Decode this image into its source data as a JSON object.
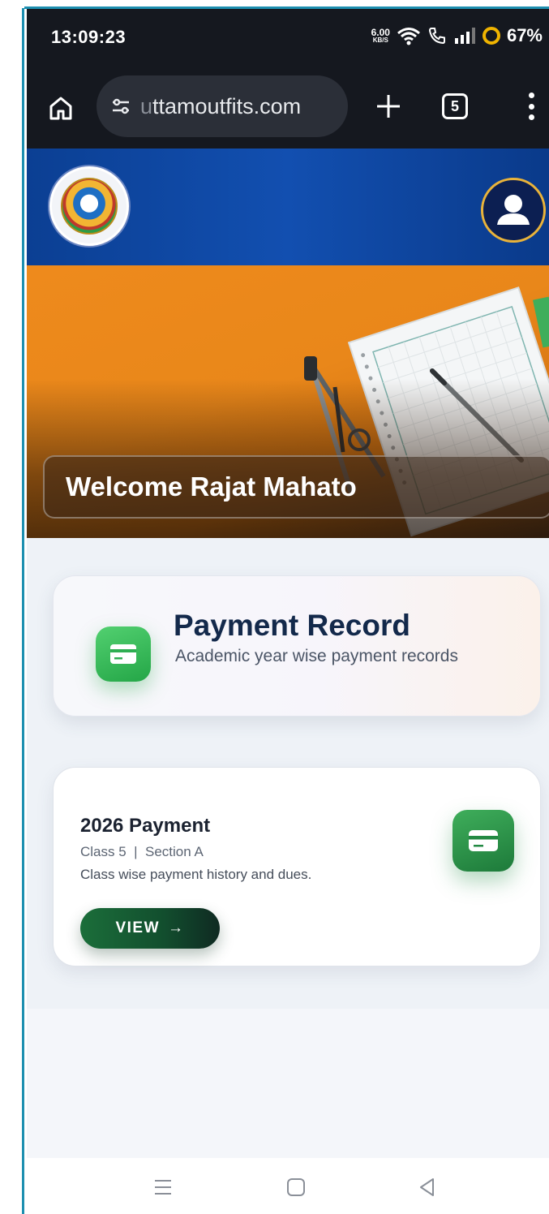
{
  "status_bar": {
    "time": "13:09:23",
    "net_speed": "6.00",
    "net_unit": "KB/S",
    "battery": "67%",
    "icons": [
      "wifi-icon",
      "call-icon",
      "signal-icon",
      "battery-ring-icon"
    ]
  },
  "browser": {
    "url_prefix": "u",
    "url": "ttamoutfits.com",
    "tab_count": "5",
    "icons": [
      "home-icon",
      "site-info-icon",
      "plus-icon",
      "tabs-icon",
      "more-vert-icon"
    ]
  },
  "header": {
    "logo_icon": "school-emblem-icon",
    "profile_icon": "user-avatar-icon"
  },
  "hero": {
    "welcome": "Welcome Rajat Mahato"
  },
  "record_card": {
    "icon": "card-icon",
    "title": "Payment Record",
    "subtitle": "Academic year wise payment records"
  },
  "payment_card": {
    "icon": "card-icon",
    "title": "2026 Payment",
    "class_line": "Class 5  |  Section A",
    "description": "Class wise payment history and dues.",
    "button_label": "VIEW",
    "button_arrow": "→"
  },
  "nav": {
    "icons": [
      "recents-icon",
      "home-square-icon",
      "back-triangle-icon"
    ]
  },
  "colors": {
    "header_blue": "#124fb0",
    "hero_orange": "#ee8a1c",
    "green": "#24a647",
    "view_button": "#1b6e3a",
    "title_navy": "#13294b"
  }
}
